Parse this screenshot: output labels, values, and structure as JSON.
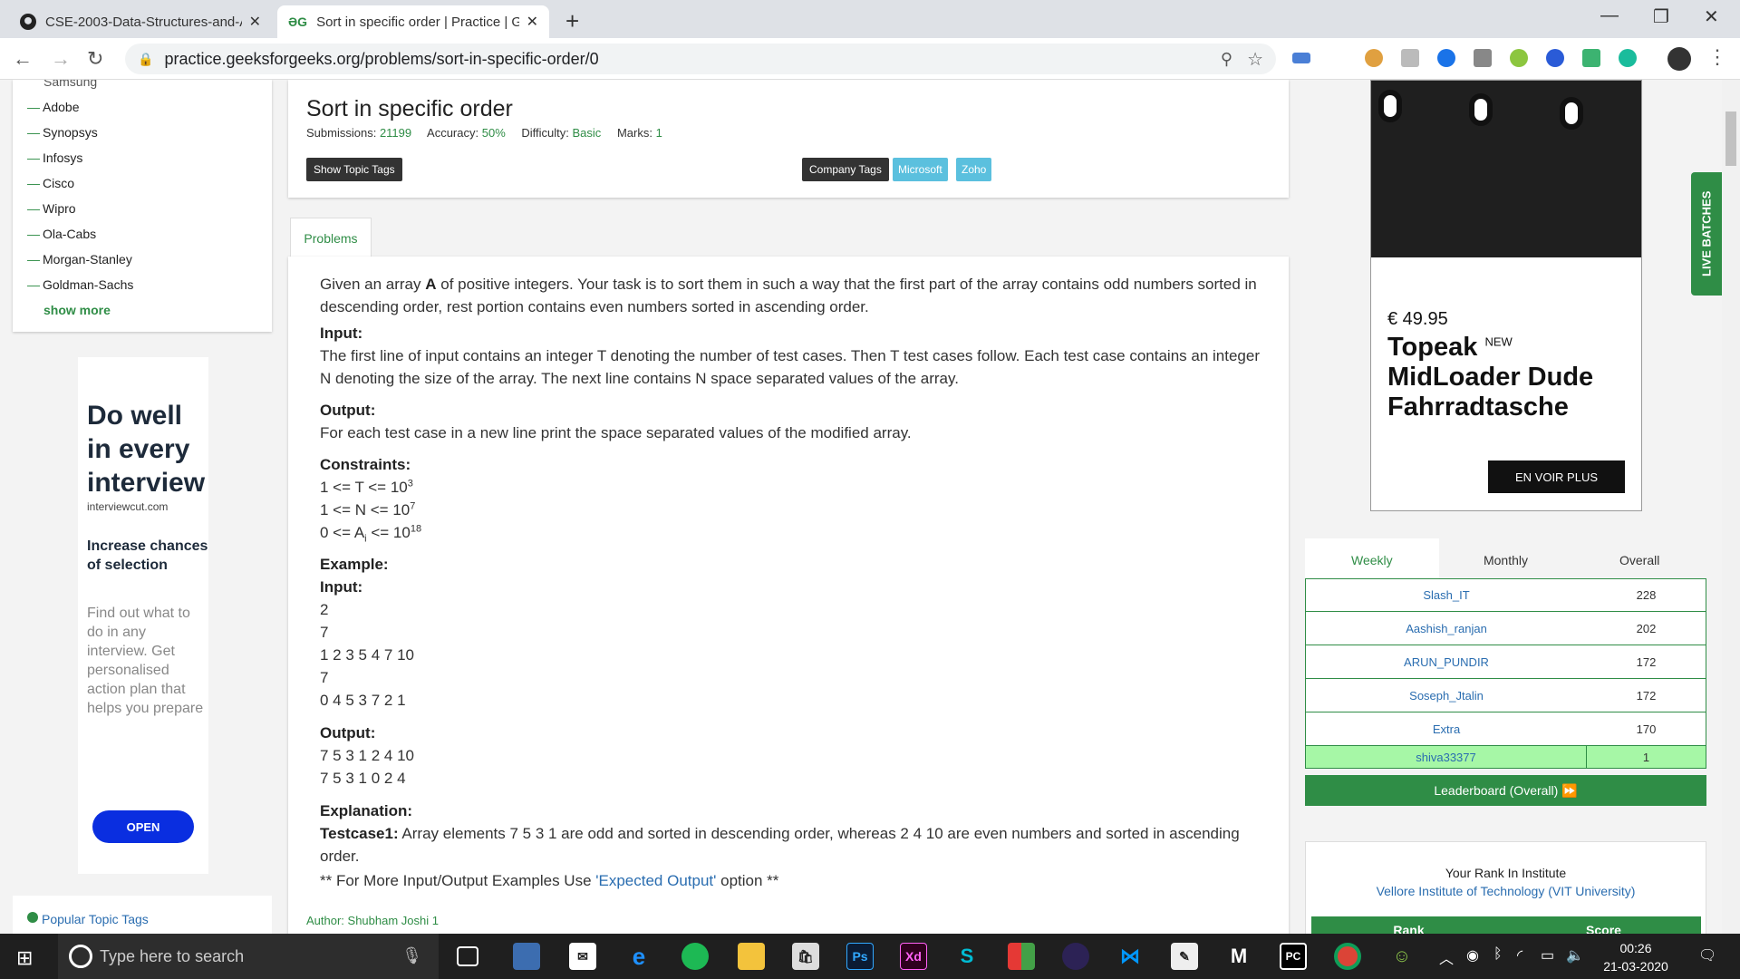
{
  "browser": {
    "tabs": [
      {
        "title": "CSE-2003-Data-Structures-and-A",
        "favicon": "github-icon"
      },
      {
        "title": "Sort in specific order | Practice | G",
        "favicon": "gfg-icon"
      }
    ],
    "url": "practice.geeksforgeeks.org/problems/sort-in-specific-order/0"
  },
  "sidebar": {
    "partial_top": "Samsung",
    "companies": [
      "Adobe",
      "Synopsys",
      "Infosys",
      "Cisco",
      "Wipro",
      "Ola-Cabs",
      "Morgan-Stanley",
      "Goldman-Sachs"
    ],
    "show_more": "show more",
    "popular_topic_tags": "Popular Topic Tags"
  },
  "ad_left": {
    "headline": "Do well in every interview",
    "domain": "interviewcut.com",
    "subhead": "Increase chances of selection",
    "desc": "Find out what to do in any interview. Get personalised action plan that helps you prepare",
    "cta": "OPEN"
  },
  "problem": {
    "title": "Sort in specific order",
    "submissions_label": "Submissions:",
    "submissions": "21199",
    "accuracy_label": "Accuracy:",
    "accuracy": "50%",
    "difficulty_label": "Difficulty:",
    "difficulty": "Basic",
    "marks_label": "Marks:",
    "marks": "1",
    "show_topic_tags": "Show Topic Tags",
    "company_tags_label": "Company Tags",
    "company_tags": [
      "Microsoft",
      "Zoho"
    ],
    "tab": "Problems",
    "statement_1": "Given an array ",
    "statement_A": "A",
    "statement_2": " of positive integers. Your task is to sort them in such a way that the first part of the array contains odd numbers sorted in descending order, rest portion contains even numbers sorted in ascending order.",
    "input_h": "Input:",
    "input_text": "The first line of input contains an integer T denoting the number of test cases. Then T test cases follow. Each test case contains an integer N denoting the size of the array. The next line contains N space separated values of the array.",
    "output_h": "Output:",
    "output_text": "For each test case in a new line print the space separated values of the modified array.",
    "constraints_h": "Constraints:",
    "c1": "1 <= T <= 10",
    "c1_exp": "3",
    "c2": "1 <= N <= 10",
    "c2_exp": "7",
    "c3_pre": "0 <= A",
    "c3_sub": "i",
    "c3_post": " <= 10",
    "c3_exp": "18",
    "example_h": "Example:",
    "ex_input_h": "Input:",
    "ex_input": [
      "2",
      "7",
      "1 2 3 5 4 7 10",
      "7",
      "0 4 5 3 7 2 1"
    ],
    "ex_output_h": "Output:",
    "ex_output": [
      "7 5 3 1 2 4 10",
      "7 5 3 1 0 2 4"
    ],
    "explanation_h": "Explanation:",
    "tc1_label": "Testcase1:",
    "tc1_text": " Array elements 7 5 3 1 are odd and sorted in descending order, whereas 2 4 10 are even numbers and sorted in ascending order.",
    "more_pre": "** For More Input/Output Examples Use ",
    "more_link": "'Expected Output'",
    "more_post": " option **",
    "author": "Author: Shubham Joshi 1"
  },
  "ad_right": {
    "price": "€ 49.95",
    "brand": "Topeak",
    "new": "NEW",
    "product": "MidLoader Dude Fahrradtasche",
    "cta": "EN VOIR PLUS"
  },
  "live_batches": "LIVE BATCHES",
  "leaderboard": {
    "tabs": [
      "Weekly",
      "Monthly",
      "Overall"
    ],
    "rows": [
      {
        "name": "Slash_IT",
        "score": "228"
      },
      {
        "name": "Aashish_ranjan",
        "score": "202"
      },
      {
        "name": "ARUN_PUNDIR",
        "score": "172"
      },
      {
        "name": "Soseph_Jtalin",
        "score": "172"
      },
      {
        "name": "Extra",
        "score": "170"
      }
    ],
    "me": {
      "name": "shiva33377",
      "score": "1"
    },
    "button": "Leaderboard (Overall) ⏩"
  },
  "rank": {
    "title": "Your Rank In Institute",
    "institute": "Vellore Institute of Technology (VIT University)",
    "col1": "Rank",
    "col2": "Score"
  },
  "taskbar": {
    "search_placeholder": "Type here to search",
    "time": "00:26",
    "date": "21-03-2020"
  },
  "colors": {
    "accent": "#2f8d46",
    "link": "#2a6db0"
  }
}
